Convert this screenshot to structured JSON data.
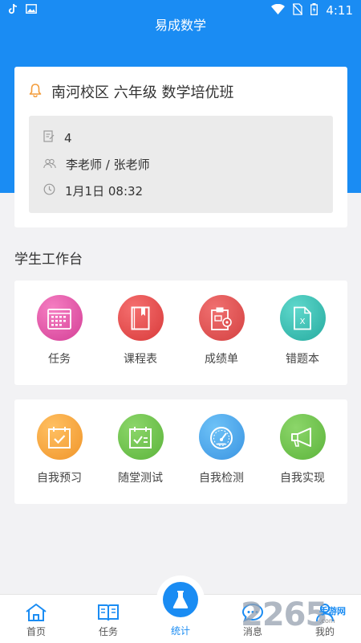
{
  "status_bar": {
    "time": "4:11"
  },
  "app": {
    "title": "易成数学"
  },
  "class_card": {
    "name": "南河校区 六年级 数学培优班",
    "count": "4",
    "teachers": "李老师 / 张老师",
    "datetime": "1月1日 08:32"
  },
  "workspace": {
    "title": "学生工作台",
    "row1": [
      {
        "label": "任务",
        "icon": "calendar-icon",
        "color": "#e356a8"
      },
      {
        "label": "课程表",
        "icon": "book-icon",
        "color": "#e24f4f"
      },
      {
        "label": "成绩单",
        "icon": "clipboard-icon",
        "color": "#e05252"
      },
      {
        "label": "错题本",
        "icon": "excel-file-icon",
        "color": "#38bdb1"
      }
    ],
    "row2": [
      {
        "label": "自我预习",
        "icon": "calendar-check-icon",
        "color": "#f5a743"
      },
      {
        "label": "随堂测试",
        "icon": "calendar-test-icon",
        "color": "#72c44f"
      },
      {
        "label": "自我检测",
        "icon": "speedometer-icon",
        "color": "#4aa6ec"
      },
      {
        "label": "自我实现",
        "icon": "megaphone-icon",
        "color": "#72c44f"
      }
    ]
  },
  "tabbar": {
    "items": [
      {
        "label": "首页",
        "icon": "home-icon"
      },
      {
        "label": "任务",
        "icon": "open-book-icon"
      },
      {
        "label": "统计",
        "icon": "flask-icon",
        "active": true
      },
      {
        "label": "消息",
        "icon": "chat-icon"
      },
      {
        "label": "我的",
        "icon": "person-icon"
      }
    ],
    "accent": "#1a8cf3"
  },
  "watermark": {
    "number": "2265",
    "suffix": ".com",
    "text": "手游网"
  }
}
